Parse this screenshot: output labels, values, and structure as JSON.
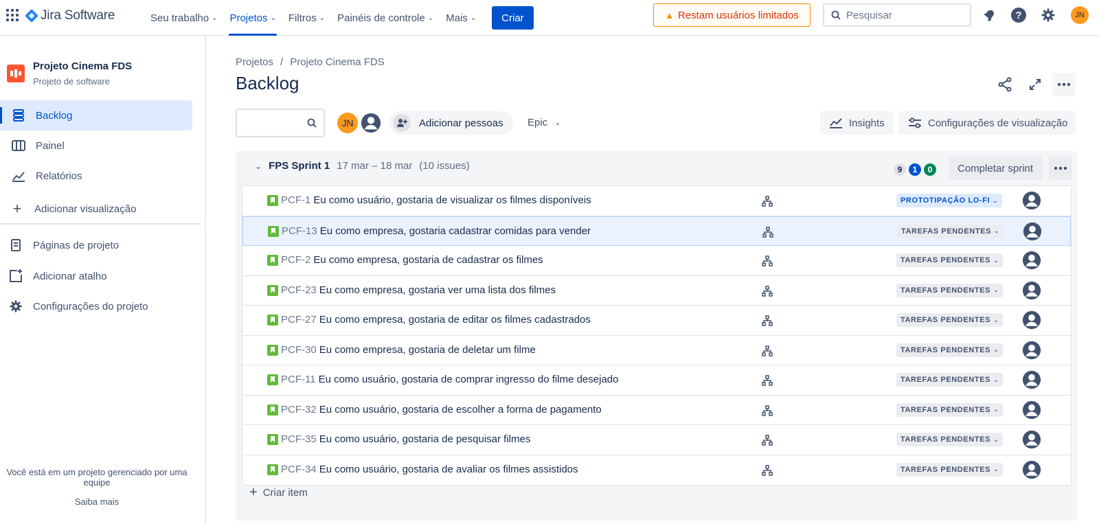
{
  "topnav": {
    "brand": "Jira Software",
    "items": [
      {
        "label": "Seu trabalho"
      },
      {
        "label": "Projetos"
      },
      {
        "label": "Filtros"
      },
      {
        "label": "Painéis de controle"
      },
      {
        "label": "Mais"
      }
    ],
    "active_item": "Projetos",
    "create_label": "Criar",
    "warning_label": "Restam usuários limitados",
    "search_placeholder": "Pesquisar",
    "user_initials": "JN",
    "icons": [
      "app-switcher-icon",
      "notifications-icon",
      "help-icon",
      "settings-icon"
    ]
  },
  "sidebar": {
    "project_name": "Projeto Cinema FDS",
    "project_type": "Projeto de software",
    "items": [
      {
        "label": "Backlog",
        "icon": "backlog-icon",
        "active": true
      },
      {
        "label": "Painel",
        "icon": "board-icon"
      },
      {
        "label": "Relatórios",
        "icon": "reports-icon"
      },
      {
        "label": "Adicionar visualização",
        "icon": "plus-icon"
      },
      {
        "label": "Páginas de projeto",
        "icon": "page-icon"
      },
      {
        "label": "Adicionar atalho",
        "icon": "add-shortcut-icon"
      },
      {
        "label": "Configurações do projeto",
        "icon": "gear-icon"
      }
    ],
    "footer_text": "Você está em um projeto gerenciado por uma equipe",
    "footer_link": "Saiba mais"
  },
  "main": {
    "breadcrumb": [
      "Projetos",
      "/",
      "Projeto Cinema FDS"
    ],
    "title": "Backlog",
    "avatar_initials": "JN",
    "add_people_label": "Adicionar pessoas",
    "epic_label": "Epic",
    "insights_label": "Insights",
    "view_settings_label": "Configurações de visualização"
  },
  "sprint": {
    "name": "FPS Sprint 1",
    "dates": "17 mar – 18 mar",
    "issue_count": "(10 issues)",
    "counts": {
      "todo": "9",
      "in_progress": "1",
      "done": "0"
    },
    "complete_label": "Completar sprint",
    "create_item_label": "Criar item",
    "issues": [
      {
        "key": "PCF-1",
        "summary": "Eu como usuário, gostaria de visualizar os filmes disponíveis",
        "status": "PROTOTIPAÇÃO LO-FI",
        "status_color": "#0052cc"
      },
      {
        "key": "PCF-13",
        "summary": "Eu como empresa, gostaria cadastrar comidas para vender",
        "status": "TAREFAS PENDENTES",
        "status_color": "#42526e"
      },
      {
        "key": "PCF-2",
        "summary": "Eu como empresa, gostaria de cadastrar os filmes",
        "status": "TAREFAS PENDENTES",
        "status_color": "#42526e"
      },
      {
        "key": "PCF-23",
        "summary": "Eu como empresa, gostaria ver uma lista dos filmes",
        "status": "TAREFAS PENDENTES",
        "status_color": "#42526e"
      },
      {
        "key": "PCF-27",
        "summary": "Eu como empresa, gostaria de editar os filmes cadastrados",
        "status": "TAREFAS PENDENTES",
        "status_color": "#42526e"
      },
      {
        "key": "PCF-30",
        "summary": "Eu como empresa, gostaria de deletar um filme",
        "status": "TAREFAS PENDENTES",
        "status_color": "#42526e"
      },
      {
        "key": "PCF-11",
        "summary": "Eu como usuário, gostaria de comprar ingresso do filme desejado",
        "status": "TAREFAS PENDENTES",
        "status_color": "#42526e"
      },
      {
        "key": "PCF-32",
        "summary": "Eu como usuário, gostaria de escolher a forma de pagamento",
        "status": "TAREFAS PENDENTES",
        "status_color": "#42526e"
      },
      {
        "key": "PCF-35",
        "summary": "Eu como usuário, gostaria de pesquisar filmes",
        "status": "TAREFAS PENDENTES",
        "status_color": "#42526e"
      },
      {
        "key": "PCF-34",
        "summary": "Eu como usuário, gostaria de avaliar os filmes assistidos",
        "status": "TAREFAS PENDENTES",
        "status_color": "#42526e"
      }
    ]
  },
  "colors": {
    "brand": "#0052cc",
    "story": "#63ba3c",
    "warning": "#ff8b00",
    "project_logo": "#ff5630"
  }
}
